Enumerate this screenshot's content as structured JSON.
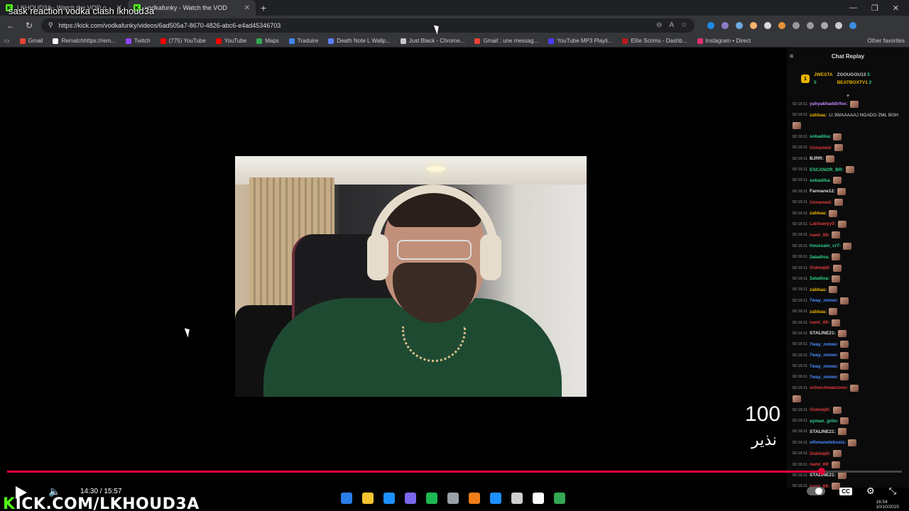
{
  "overlay_title": "sask reaction vodka clash lkhoud3a",
  "tabs": [
    {
      "label": "LKHOUD3A - Watch the VOD o",
      "fav": "K"
    },
    {
      "label": "vodkafunky - Watch the VOD",
      "fav": "K"
    }
  ],
  "url": "https://kick.com/vodkafunky/videos/6ad505a7-8670-4826-abc6-e4ad45346703",
  "bookmarks": [
    {
      "label": "Gmail",
      "color": "#ea4335"
    },
    {
      "label": "Rematchhttps://rem...",
      "color": "#ffffff"
    },
    {
      "label": "Twitch",
      "color": "#9146ff"
    },
    {
      "label": "(775) YouTube",
      "color": "#ff0000"
    },
    {
      "label": "YouTube",
      "color": "#ff0000"
    },
    {
      "label": "Maps",
      "color": "#34a853"
    },
    {
      "label": "Traduire",
      "color": "#4285f4"
    },
    {
      "label": "Death Note L Wallp...",
      "color": "#5b7fff"
    },
    {
      "label": "Just Black - Chrome...",
      "color": "#c7c7c7"
    },
    {
      "label": "Gmail : une messag...",
      "color": "#ea4335"
    },
    {
      "label": "YouTube MP3 Playli...",
      "color": "#4a3aff"
    },
    {
      "label": "Elite Scrims - Dashb...",
      "color": "#b71c1c"
    },
    {
      "label": "Instagram • Direct",
      "color": "#e1306c"
    }
  ],
  "bookmarks_other": "Other favorites",
  "chat": {
    "title": "Chat Replay",
    "leaders": [
      {
        "name": "JWESTA",
        "count": "5"
      },
      {
        "name": "ZGOUGOU13",
        "count": "5"
      },
      {
        "name": "BEATBOXTV1",
        "count": "2"
      }
    ],
    "messages": [
      {
        "ts": "02:16:11",
        "user": "yahyakhaddirfox:",
        "color": "#c38bff",
        "text": ""
      },
      {
        "ts": "02:16:11",
        "user": "zabbaa:",
        "color": "#e8b400",
        "text": "LI 3WAAAAAJ NGADO ZML BOH"
      },
      {
        "ts": "",
        "user": "",
        "color": "#ddd",
        "text": ""
      },
      {
        "ts": "02:16:11",
        "user": "sobadika:",
        "color": "#2fd38a",
        "text": ""
      },
      {
        "ts": "02:16:11",
        "user": "Unnamed:",
        "color": "#e03a3a",
        "text": ""
      },
      {
        "ts": "02:16:11",
        "user": "BJRR:",
        "color": "#dddddd",
        "text": ""
      },
      {
        "ts": "02:16:11",
        "user": "ESCANOR_BR:",
        "color": "#2fd38a",
        "text": ""
      },
      {
        "ts": "02:16:11",
        "user": "sobadika:",
        "color": "#2fd38a",
        "text": ""
      },
      {
        "ts": "02:16:11",
        "user": "Fannane12:",
        "color": "#dddddd",
        "text": ""
      },
      {
        "ts": "02:16:11",
        "user": "Unnamed:",
        "color": "#e03a3a",
        "text": ""
      },
      {
        "ts": "02:16:11",
        "user": "zabbaa:",
        "color": "#e8b400",
        "text": ""
      },
      {
        "ts": "02:16:11",
        "user": "Lakhawyy0:",
        "color": "#e03a3a",
        "text": ""
      },
      {
        "ts": "02:16:11",
        "user": "nami_69:",
        "color": "#e03a3a",
        "text": ""
      },
      {
        "ts": "02:16:11",
        "user": "houssam_cr7:",
        "color": "#2fd38a",
        "text": ""
      },
      {
        "ts": "02:16:11",
        "user": "3aladina:",
        "color": "#2fd38a",
        "text": ""
      },
      {
        "ts": "02:16:11",
        "user": "Oubiwjdi:",
        "color": "#e03a3a",
        "text": ""
      },
      {
        "ts": "02:16:11",
        "user": "3aladina:",
        "color": "#2fd38a",
        "text": ""
      },
      {
        "ts": "02:16:11",
        "user": "zabbaa:",
        "color": "#e8b400",
        "text": ""
      },
      {
        "ts": "02:16:11",
        "user": "7way_nmwe:",
        "color": "#4a8cff",
        "text": ""
      },
      {
        "ts": "02:16:11",
        "user": "zabbaa:",
        "color": "#e8b400",
        "text": ""
      },
      {
        "ts": "02:16:11",
        "user": "nami_69:",
        "color": "#e03a3a",
        "text": ""
      },
      {
        "ts": "02:16:11",
        "user": "STALINE21:",
        "color": "#dddddd",
        "text": ""
      },
      {
        "ts": "02:16:11",
        "user": "7way_nmwe:",
        "color": "#4a8cff",
        "text": ""
      },
      {
        "ts": "02:16:11",
        "user": "7way_nmwe:",
        "color": "#4a8cff",
        "text": ""
      },
      {
        "ts": "02:16:11",
        "user": "7way_nmwe:",
        "color": "#4a8cff",
        "text": ""
      },
      {
        "ts": "02:16:11",
        "user": "7way_nmwe:",
        "color": "#4a8cff",
        "text": ""
      },
      {
        "ts": "02:16:11",
        "user": "ucheichwakzooo:",
        "color": "#e03a3a",
        "text": ""
      },
      {
        "ts": "",
        "user": "",
        "color": "#ddd",
        "text": ""
      },
      {
        "ts": "02:16:11",
        "user": "Oubiwjdi:",
        "color": "#e03a3a",
        "text": ""
      },
      {
        "ts": "02:16:11",
        "user": "ayman_grilo:",
        "color": "#2fd38a",
        "text": ""
      },
      {
        "ts": "02:16:11",
        "user": "STALINE21:",
        "color": "#dddddd",
        "text": ""
      },
      {
        "ts": "02:16:11",
        "user": "othmanelebssis:",
        "color": "#4a8cff",
        "text": ""
      },
      {
        "ts": "02:16:11",
        "user": "Oubiwjdi:",
        "color": "#e03a3a",
        "text": ""
      },
      {
        "ts": "02:16:11",
        "user": "nami_69:",
        "color": "#e03a3a",
        "text": ""
      },
      {
        "ts": "02:16:11",
        "user": "STALINE21:",
        "color": "#dddddd",
        "text": ""
      },
      {
        "ts": "02:16:11",
        "user": "nami_69:",
        "color": "#e03a3a",
        "text": ""
      }
    ]
  },
  "counter": "100",
  "counter_name": "نذير",
  "player": {
    "time": "14:30 / 15:57",
    "progress": 0.91,
    "kick_prefix": "K",
    "kick_rest": "ICK.COM/LKHOUD3A"
  },
  "clock": {
    "time": "16:54",
    "date": "10/10/2025"
  },
  "taskbar_colors": [
    "#2b7de9",
    "#f4c430",
    "#1e90ff",
    "#7b68ee",
    "#1db954",
    "#9aa0a6",
    "#f07d1a",
    "#1e90ff",
    "#cfcfcf",
    "#ffffff",
    "#34a853"
  ]
}
